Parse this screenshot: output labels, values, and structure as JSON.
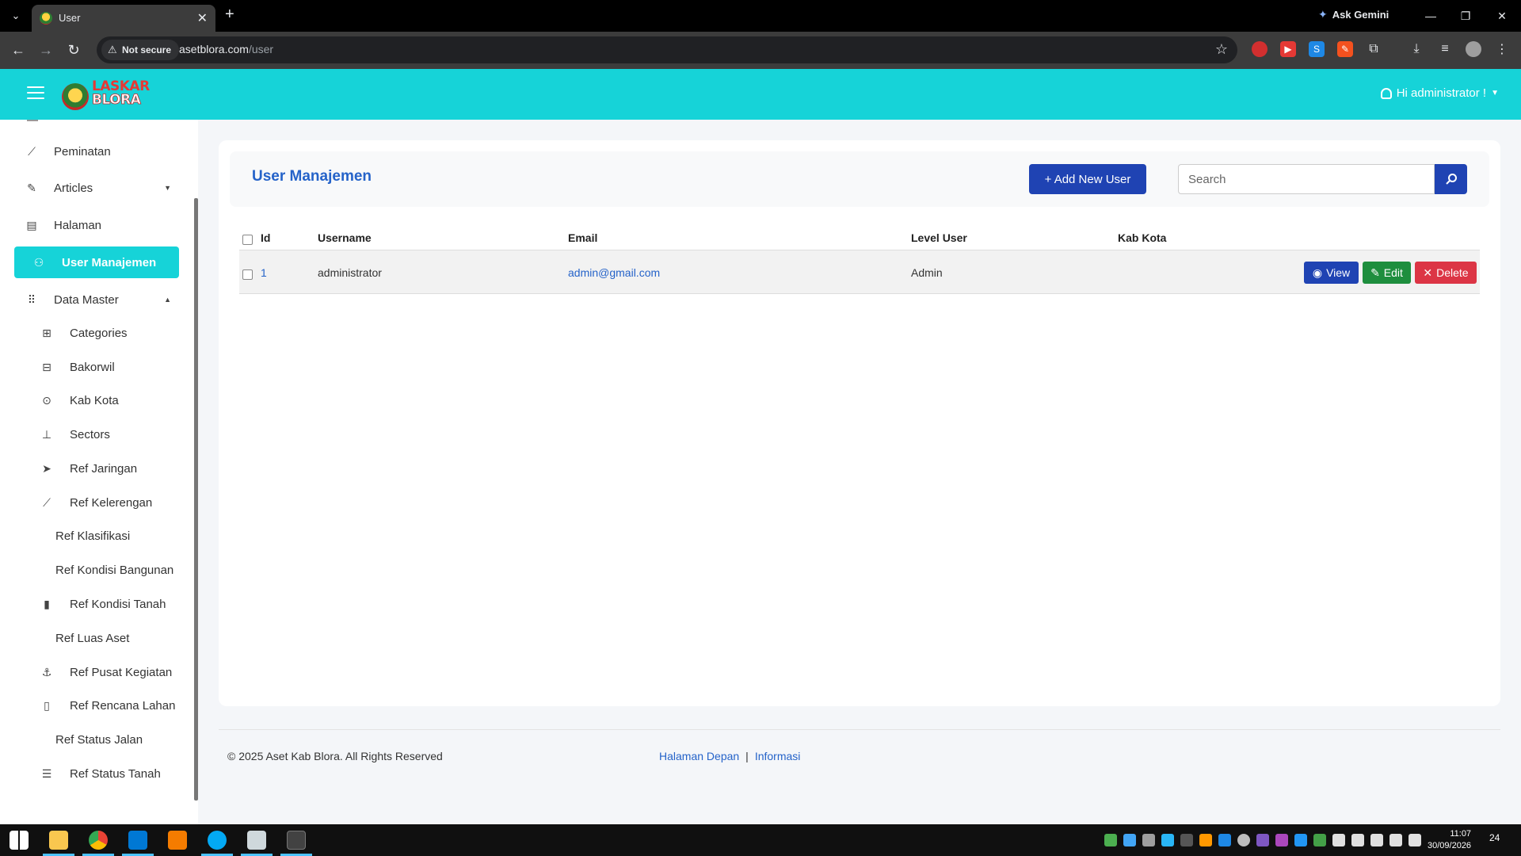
{
  "browser": {
    "tab_title": "User",
    "ask_gemini": "Ask Gemini",
    "not_secure": "Not secure",
    "url_host": "asetblora.com",
    "url_path": "/user"
  },
  "header": {
    "logo_line1": "LASKAR",
    "logo_line2": "BLORA",
    "user_greeting": "Hi administrator !"
  },
  "sidebar": {
    "items": [
      {
        "label": "Peminatan",
        "icon": "chart-line-icon"
      },
      {
        "label": "Articles",
        "icon": "edit-icon"
      },
      {
        "label": "Halaman",
        "icon": "document-icon"
      },
      {
        "label": "User Manajemen",
        "icon": "user-icon",
        "active": true
      },
      {
        "label": "Data Master",
        "icon": "grid-icon"
      },
      {
        "label": "Categories",
        "icon": "categories-icon"
      },
      {
        "label": "Bakorwil",
        "icon": "map-icon"
      },
      {
        "label": "Kab Kota",
        "icon": "location-pin-icon"
      },
      {
        "label": "Sectors",
        "icon": "sitemap-icon"
      },
      {
        "label": "Ref Jaringan",
        "icon": "send-icon"
      },
      {
        "label": "Ref Kelerengan",
        "icon": "chart-line-icon"
      },
      {
        "label": "Ref Klasifikasi"
      },
      {
        "label": "Ref Kondisi Bangunan"
      },
      {
        "label": "Ref Kondisi Tanah",
        "icon": "bar-chart-icon"
      },
      {
        "label": "Ref Luas Aset"
      },
      {
        "label": "Ref Pusat Kegiatan",
        "icon": "anchor-icon"
      },
      {
        "label": "Ref Rencana Lahan",
        "icon": "clipboard-icon"
      },
      {
        "label": "Ref Status Jalan"
      },
      {
        "label": "Ref Status Tanah",
        "icon": "list-icon"
      }
    ]
  },
  "main": {
    "title": "User Manajemen",
    "add_button": "+ Add New User",
    "search_placeholder": "Search",
    "columns": [
      "Id",
      "Username",
      "Email",
      "Level User",
      "Kab Kota"
    ],
    "rows": [
      {
        "id": "1",
        "username": "administrator",
        "email": "admin@gmail.com",
        "level": "Admin",
        "kab_kota": ""
      }
    ],
    "actions": {
      "view": "View",
      "edit": "Edit",
      "delete": "Delete"
    }
  },
  "footer": {
    "copyright": "© 2025 Aset Kab Blora. All Rights Reserved",
    "link1": "Halaman Depan",
    "separator": "|",
    "link2": "Informasi"
  },
  "taskbar": {
    "time": "11:07",
    "date": "30/09/2026",
    "notifications": "24"
  },
  "colors": {
    "header": "#16d3d8",
    "primary": "#1f43b3",
    "edit": "#1e8e3e",
    "delete": "#dc3545",
    "link": "#2563c9"
  }
}
